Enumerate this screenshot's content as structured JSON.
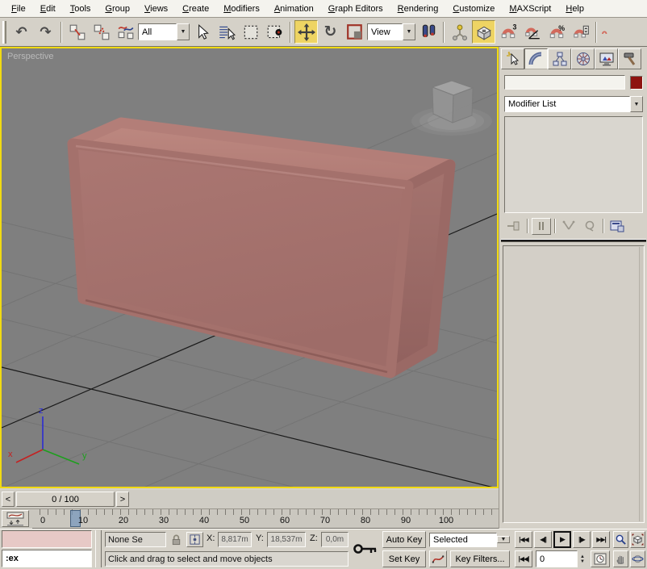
{
  "menubar": {
    "items": [
      "File",
      "Edit",
      "Tools",
      "Group",
      "Views",
      "Create",
      "Modifiers",
      "Animation",
      "Graph Editors",
      "Rendering",
      "Customize",
      "MAXScript",
      "Help"
    ]
  },
  "toolbar": {
    "selection_filter": "All",
    "coordinate_system": "View",
    "snap_superscript": "3",
    "snap_percent": "%",
    "snap_angle": "∠"
  },
  "icons": {
    "undo": "↶",
    "redo": "↷",
    "rotate": "↻",
    "dropdown_arrow": "▼",
    "spinner_up": "▲",
    "spinner_down": "▼"
  },
  "viewport": {
    "label": "Perspective",
    "axis_x": "x",
    "axis_y": "y",
    "axis_z": "z"
  },
  "command_panel": {
    "modifier_list": "Modifier List",
    "object_name": "",
    "object_color": "#8e1310"
  },
  "time_slider": {
    "prev": "<",
    "value": "0 / 100",
    "next": ">"
  },
  "timeline": {
    "ticks": [
      "0",
      "10",
      "20",
      "30",
      "40",
      "50",
      "60",
      "70",
      "80",
      "90",
      "100"
    ],
    "current_frame": "0"
  },
  "playback": {
    "go_start": "|◀◀",
    "prev_frame": "◀||",
    "play": "▶",
    "next_frame": "||▶",
    "go_end": "▶▶|",
    "key_step": "|◀◀|"
  },
  "status": {
    "listener_text": ":ex",
    "selection_status": "None Se",
    "x_label": "X:",
    "x_value": "8,817m",
    "y_label": "Y:",
    "y_value": "18,537m",
    "z_label": "Z:",
    "z_value": "0,0m",
    "prompt": "Click and drag to select and move objects",
    "auto_key": "Auto Key",
    "set_key": "Set Key",
    "key_mode": "Selected",
    "key_filters": "Key Filters...",
    "frame": "0"
  }
}
